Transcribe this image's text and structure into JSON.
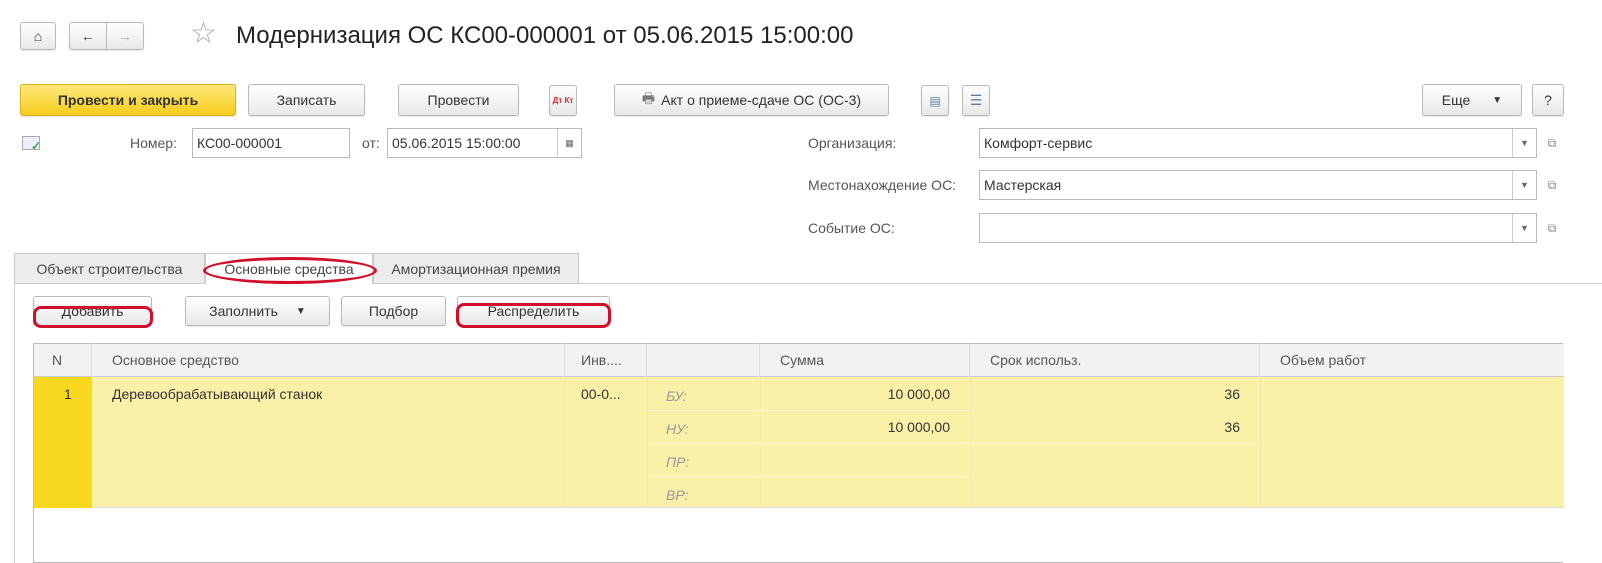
{
  "header": {
    "title": "Модернизация ОС КС00-000001 от 05.06.2015 15:00:00"
  },
  "toolbar": {
    "post_close": "Провести и закрыть",
    "save": "Записать",
    "post": "Провести",
    "dt_kt": "Дт Кт",
    "print_act": "Акт о приеме-сдаче ОС (ОС-3)",
    "more": "Еще",
    "help": "?"
  },
  "form": {
    "number_label": "Номер:",
    "number_value": "КС00-000001",
    "date_label": "от:",
    "date_value": "05.06.2015 15:00:00",
    "org_label": "Организация:",
    "org_value": "Комфорт-сервис",
    "location_label": "Местонахождение ОС:",
    "location_value": "Мастерская",
    "event_label": "Событие ОС:",
    "event_value": ""
  },
  "tabs": [
    "Объект строительства",
    "Основные средства",
    "Амортизационная премия"
  ],
  "table_toolbar": {
    "add": "Добавить",
    "fill": "Заполнить",
    "select": "Подбор",
    "distribute": "Распределить"
  },
  "table": {
    "headers": [
      "N",
      "Основное средство",
      "Инв....",
      "",
      "Сумма",
      "Срок использ.",
      "Объем работ"
    ],
    "rows": [
      {
        "n": "1",
        "asset": "Деревообрабатывающий станок",
        "inv": "00-0...",
        "sub_labels": [
          "БУ:",
          "НУ:",
          "ПР:",
          "ВР:"
        ],
        "sums": [
          "10 000,00",
          "10 000,00",
          "",
          ""
        ],
        "terms": [
          "36",
          "36"
        ]
      }
    ]
  },
  "colors": {
    "accent": "#f6cc1c",
    "row_highlight": "#fbf0a8",
    "row_marker": "#f8d81e",
    "annotation": "#d0102a"
  }
}
